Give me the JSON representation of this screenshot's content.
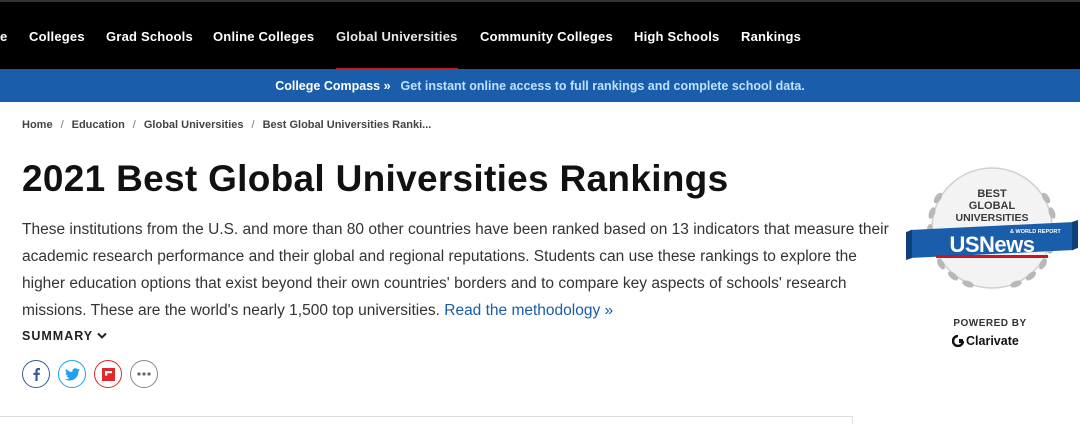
{
  "nav": {
    "items": [
      {
        "label": "e",
        "active": false
      },
      {
        "label": "Colleges",
        "active": false
      },
      {
        "label": "Grad Schools",
        "active": false
      },
      {
        "label": "Online Colleges",
        "active": false
      },
      {
        "label": "Global Universities",
        "active": true
      },
      {
        "label": "Community Colleges",
        "active": false
      },
      {
        "label": "High Schools",
        "active": false
      },
      {
        "label": "Rankings",
        "active": false
      }
    ]
  },
  "promo": {
    "label": "College Compass »",
    "link": "Get instant online access to full rankings and complete school data."
  },
  "breadcrumb": {
    "items": [
      "Home",
      "Education",
      "Global Universities",
      "Best Global Universities Ranki..."
    ],
    "separator": "/"
  },
  "page": {
    "title": "2021 Best Global Universities Rankings",
    "description": "These institutions from the U.S. and more than 80 other countries have been ranked based on 13 indicators that measure their academic research performance and their global and regional reputations. Students can use these rankings to explore the higher education options that exist beyond their own countries' borders and to compare key aspects of schools' research missions. These are the world's nearly 1,500 top universities.",
    "methodology_link": "Read the methodology »",
    "summary_label": "SUMMARY"
  },
  "share": [
    {
      "icon": "facebook-icon",
      "color": "#3b5998"
    },
    {
      "icon": "twitter-icon",
      "color": "#1da1f2"
    },
    {
      "icon": "flipboard-icon",
      "color": "#e12828"
    },
    {
      "icon": "more-icon",
      "color": "#888888"
    }
  ],
  "badge": {
    "line1": "BEST",
    "line2": "GLOBAL",
    "line3": "UNIVERSITIES",
    "brand": "USNews",
    "brand_sub": "& WORLD REPORT",
    "powered_by": "POWERED BY",
    "partner": "Clarivate"
  },
  "colors": {
    "nav_bg": "#000000",
    "promo_bg": "#1a5dab",
    "active_underline": "#c8161d",
    "link": "#1a5dab"
  }
}
